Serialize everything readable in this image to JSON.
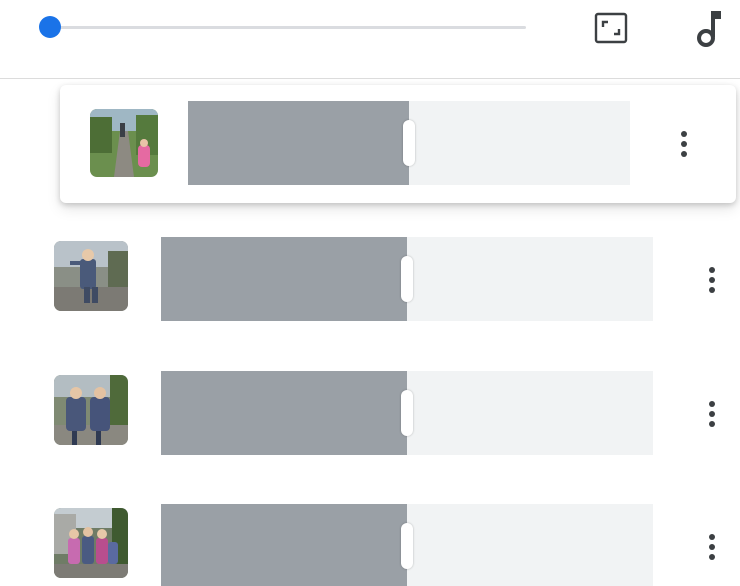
{
  "toolbar": {
    "playback_position": 0.0,
    "accent_color": "#1a73e8",
    "aspect_icon": "aspect-ratio-icon",
    "music_icon": "music-note-icon"
  },
  "clips": [
    {
      "thumbnail": "photo-girl-on-path",
      "trim_fraction": 0.5,
      "selected": true,
      "more_icon": "more-vert-icon"
    },
    {
      "thumbnail": "photo-child-posing",
      "trim_fraction": 0.5,
      "selected": false,
      "more_icon": "more-vert-icon"
    },
    {
      "thumbnail": "photo-two-children",
      "trim_fraction": 0.5,
      "selected": false,
      "more_icon": "more-vert-icon"
    },
    {
      "thumbnail": "photo-group-outdoors",
      "trim_fraction": 0.5,
      "selected": false,
      "more_icon": "more-vert-icon"
    }
  ],
  "colors": {
    "trim_fill": "#9aa0a6",
    "trim_track": "#f1f3f4",
    "divider": "#dcdcdc"
  }
}
